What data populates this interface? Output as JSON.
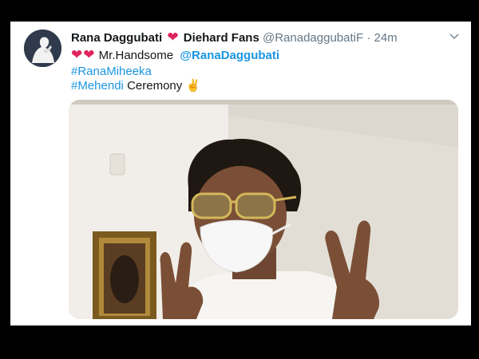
{
  "tweet": {
    "author_name": "Rana Daggubati",
    "author_suffix": "Diehard Fans",
    "handle": "@RanadaggubatiF",
    "dot": "·",
    "time": "24m",
    "heart_symbol": "❤",
    "line1_hearts": "❤❤",
    "line1_text": "Mr.Handsome",
    "line1_mention": "@RanaDaggubati",
    "hashtag1": "#RanaMiheeka",
    "hashtag2_link": "#Mehendi",
    "hashtag2_rest": "Ceremony",
    "emoji": "✌",
    "media_description": "photo-man-with-mask-and-sunglasses-showing-peace-signs"
  },
  "colors": {
    "heart": "#e0245e",
    "link": "#1b95e0",
    "muted": "#657786",
    "text": "#14171a"
  },
  "icons": {
    "avatar": "avatar-image",
    "menu": "chevron-down-icon"
  }
}
